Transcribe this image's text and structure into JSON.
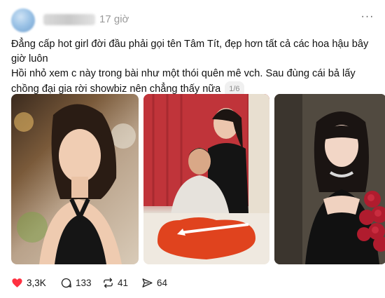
{
  "post": {
    "timestamp": "17 giờ",
    "more_label": "···",
    "text_line1": "Đẳng cấp hot girl đời đầu phải gọi tên Tâm Tít, đẹp hơn tất cả các hoa hậu bây giờ luôn",
    "text_line2": "Hồi nhỏ xem c này trong bài như một thói quên mê vch. Sau đùng cái bả lấy chồng đại gia rời showbiz nên chẳng thấy nữa",
    "image_counter": "1/6"
  },
  "actions": {
    "likes": "3,3K",
    "replies": "133",
    "reposts": "41",
    "shares": "64"
  },
  "colors": {
    "like_heart": "#ff3040",
    "muted_text": "#9a9a9a"
  },
  "icons": [
    "heart-icon",
    "comment-icon",
    "repost-icon",
    "share-icon",
    "more-icon"
  ]
}
